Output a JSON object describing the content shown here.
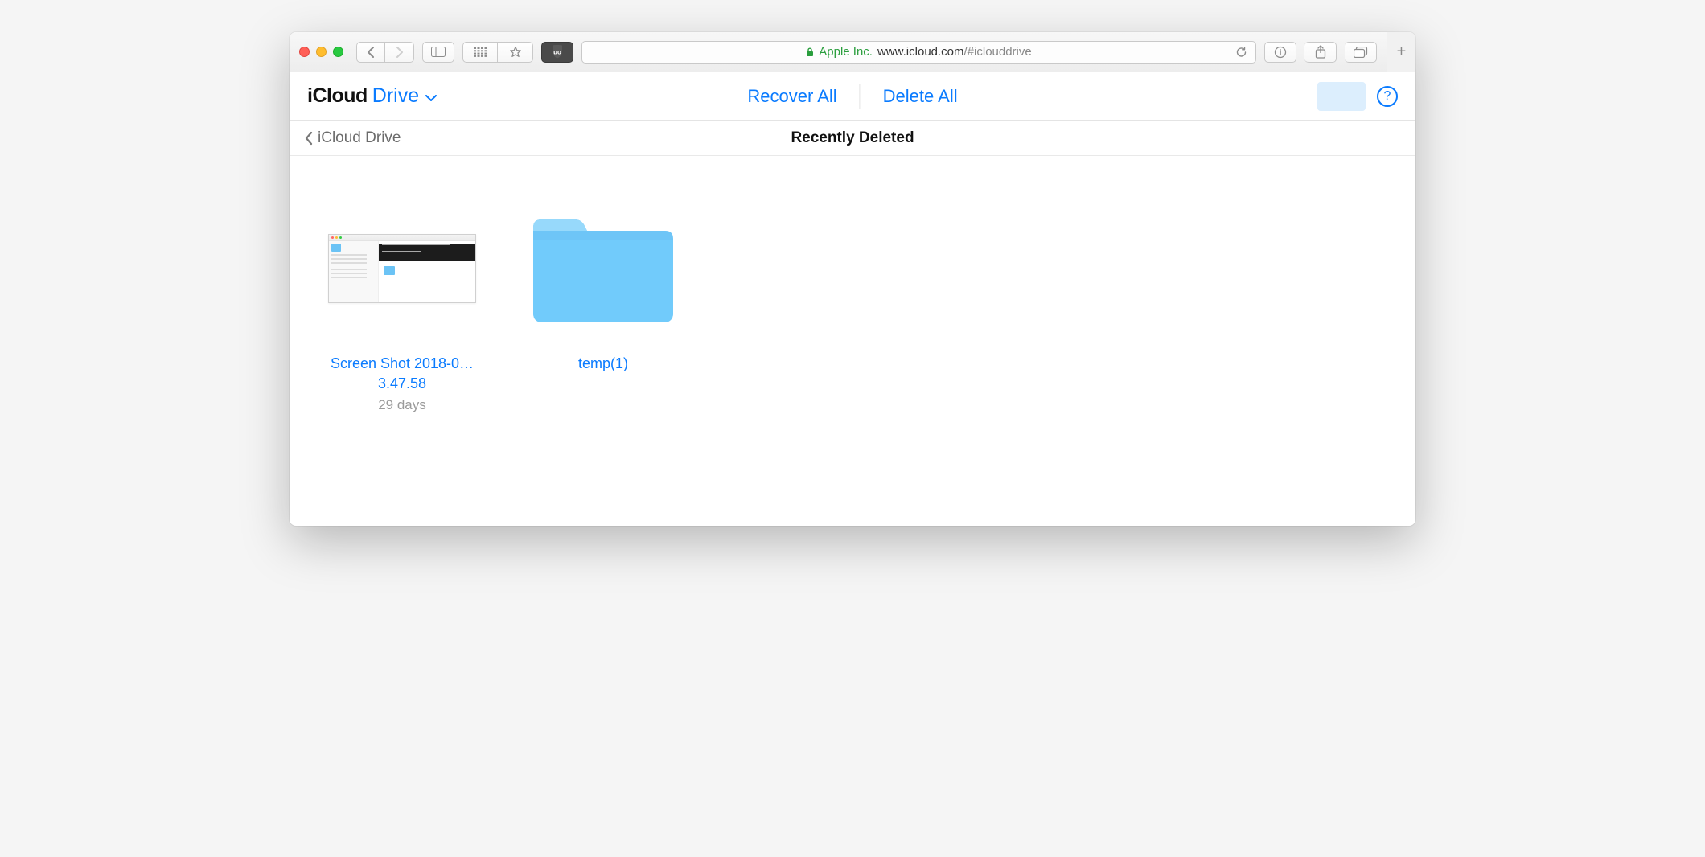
{
  "chrome": {
    "address": {
      "company": "Apple Inc.",
      "domain": "www.icloud.com",
      "path": "/#iclouddrive"
    }
  },
  "header": {
    "brand1": "iCloud",
    "brand2": "Drive",
    "actions": {
      "recover_all": "Recover All",
      "delete_all": "Delete All"
    }
  },
  "subheader": {
    "back_label": "iCloud Drive",
    "title": "Recently Deleted"
  },
  "items": [
    {
      "type": "file",
      "name": "Screen Shot 2018-0…3.47.58",
      "meta": "29 days"
    },
    {
      "type": "folder",
      "name": "temp(1)",
      "meta": ""
    }
  ]
}
